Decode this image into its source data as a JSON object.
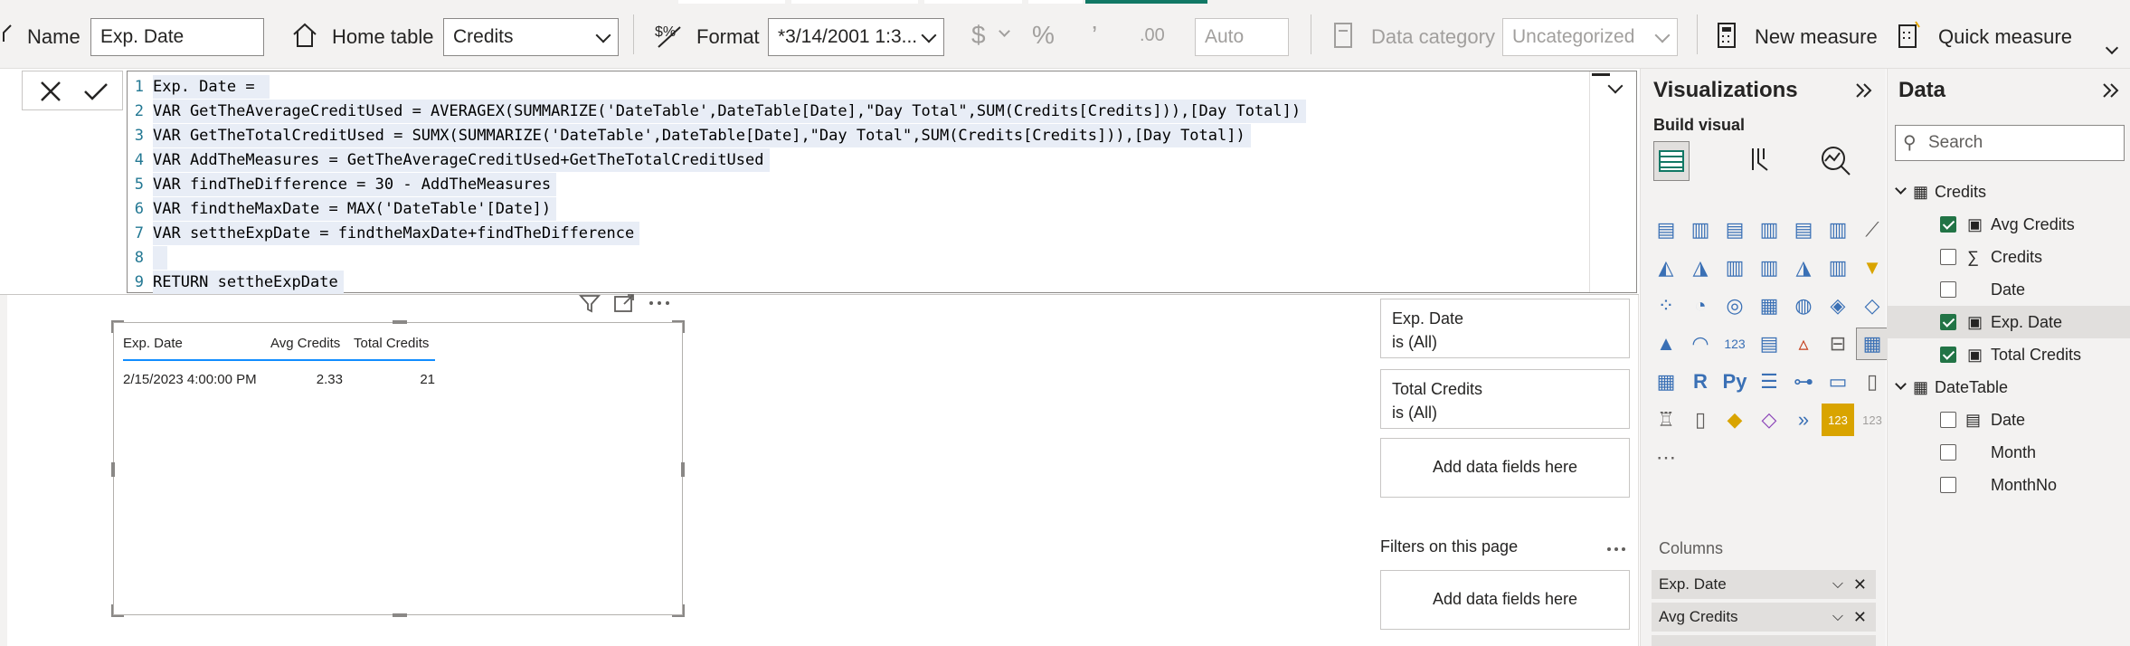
{
  "ribbon": {
    "name_label": "Name",
    "name_value": "Exp. Date",
    "home_table_label": "Home table",
    "home_table_value": "Credits",
    "format_label": "Format",
    "format_value": "*3/14/2001 1:3...",
    "currency_symbol": "$",
    "percent_symbol": "%",
    "comma_symbol": "’",
    "decimal_symbol": ".00",
    "auto_value": "Auto",
    "data_category_label": "Data category",
    "data_category_value": "Uncategorized",
    "new_measure_label": "New measure",
    "quick_measure_label": "Quick measure"
  },
  "formula": {
    "lines": [
      {
        "n": "1",
        "text": "Exp. Date = "
      },
      {
        "n": "2",
        "text": "VAR GetTheAverageCreditUsed = AVERAGEX(SUMMARIZE('DateTable',DateTable[Date],\"Day Total\",SUM(Credits[Credits])),[Day Total])"
      },
      {
        "n": "3",
        "text": "VAR GetTheTotalCreditUsed = SUMX(SUMMARIZE('DateTable',DateTable[Date],\"Day Total\",SUM(Credits[Credits])),[Day Total])"
      },
      {
        "n": "4",
        "text": "VAR AddTheMeasures = GetTheAverageCreditUsed+GetTheTotalCreditUsed"
      },
      {
        "n": "5",
        "text": "VAR findTheDifference = 30 - AddTheMeasures"
      },
      {
        "n": "6",
        "text": "VAR findtheMaxDate = MAX('DateTable'[Date])"
      },
      {
        "n": "7",
        "text": "VAR settheExpDate = findtheMaxDate+findTheDifference"
      },
      {
        "n": "8",
        "text": " "
      },
      {
        "n": "9",
        "text": "RETURN settheExpDate"
      }
    ]
  },
  "table_visual": {
    "headers": [
      "Exp. Date",
      "Avg Credits",
      "Total Credits"
    ],
    "rows": [
      [
        "2/15/2023 4:00:00 PM",
        "2.33",
        "21"
      ]
    ]
  },
  "filters": {
    "cards": [
      {
        "title": "Exp. Date",
        "sub": "is (All)"
      },
      {
        "title": "Total Credits",
        "sub": "is (All)"
      }
    ],
    "add_fields": "Add data fields here",
    "page_title": "Filters on this page",
    "page_add_fields": "Add data fields here"
  },
  "visualizations": {
    "title": "Visualizations",
    "build_visual": "Build visual",
    "columns_label": "Columns",
    "wells": [
      "Exp. Date",
      "Avg Credits"
    ]
  },
  "data_pane": {
    "title": "Data",
    "search_placeholder": "Search",
    "tables": [
      {
        "name": "Credits",
        "fields": [
          {
            "name": "Avg Credits",
            "checked": true,
            "icon": "calculator"
          },
          {
            "name": "Credits",
            "checked": false,
            "icon": "sigma"
          },
          {
            "name": "Date",
            "checked": false,
            "icon": "none"
          },
          {
            "name": "Exp. Date",
            "checked": true,
            "icon": "calculator"
          },
          {
            "name": "Total Credits",
            "checked": true,
            "icon": "calculator"
          }
        ]
      },
      {
        "name": "DateTable",
        "fields": [
          {
            "name": "Date",
            "checked": false,
            "icon": "calendar"
          },
          {
            "name": "Month",
            "checked": false,
            "icon": "none"
          },
          {
            "name": "MonthNo",
            "checked": false,
            "icon": "none"
          }
        ]
      }
    ]
  },
  "colors": {
    "accent": "#118dff",
    "checkbox_on": "#227446"
  }
}
